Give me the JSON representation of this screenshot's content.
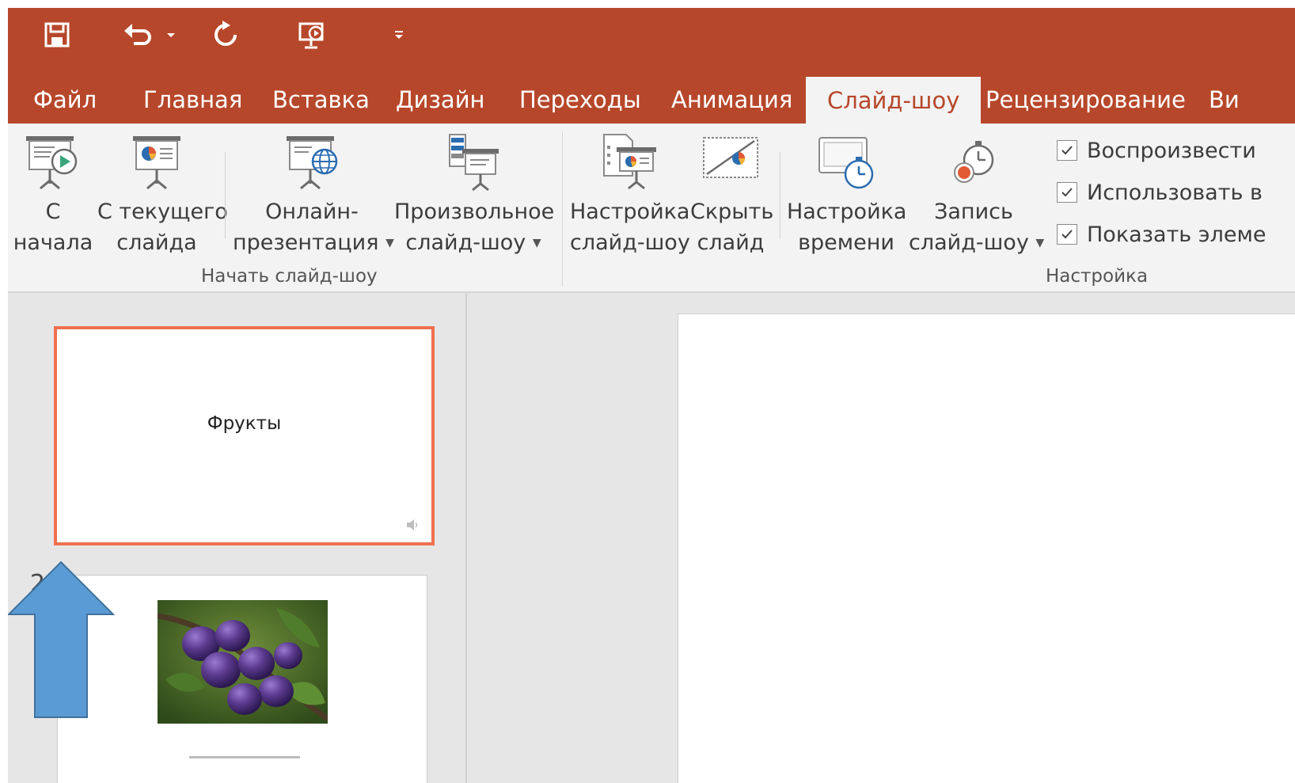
{
  "quick_access": {
    "icons": [
      "save-icon",
      "undo-icon",
      "undo-dropdown-icon",
      "redo-icon",
      "present-from-start-icon",
      "customize-qat-icon"
    ]
  },
  "tabs": [
    {
      "label": "Файл"
    },
    {
      "label": "Главная"
    },
    {
      "label": "Вставка"
    },
    {
      "label": "Дизайн"
    },
    {
      "label": "Переходы"
    },
    {
      "label": "Анимация"
    },
    {
      "label": "Слайд-шоу",
      "active": true
    },
    {
      "label": "Рецензирование"
    },
    {
      "label": "Ви"
    }
  ],
  "ribbon": {
    "start_group": {
      "label": "Начать слайд-шоу",
      "buttons": [
        {
          "line1": "С",
          "line2": "начала"
        },
        {
          "line1": "С текущего",
          "line2": "слайда"
        },
        {
          "line1": "Онлайн-",
          "line2": "презентация"
        },
        {
          "line1": "Произвольное",
          "line2": "слайд-шоу"
        }
      ]
    },
    "setup_group": {
      "label": "Настройка",
      "buttons": [
        {
          "line1": "Настройка",
          "line2": "слайд-шоу"
        },
        {
          "line1": "Скрыть",
          "line2": "слайд"
        },
        {
          "line1": "Настройка",
          "line2": "времени"
        },
        {
          "line1": "Запись",
          "line2": "слайд-шоу"
        }
      ],
      "checkboxes": [
        {
          "label": "Воспроизвести",
          "checked": true
        },
        {
          "label": "Использовать в",
          "checked": true
        },
        {
          "label": "Показать элеме",
          "checked": true
        }
      ]
    }
  },
  "slides": [
    {
      "number": "",
      "title": "Фрукты",
      "selected": true
    },
    {
      "number": "2",
      "title": ""
    }
  ],
  "colors": {
    "accent": "#b7472a",
    "selection": "#f0704f",
    "arrow": "#5b9bd5"
  }
}
